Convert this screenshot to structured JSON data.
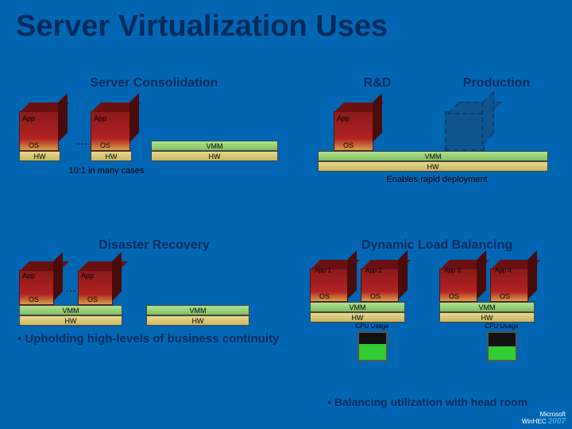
{
  "title": "Server Virtualization Uses",
  "quadrants": {
    "tl": {
      "title": "Server Consolidation",
      "app": "App",
      "os": "OS",
      "hw": "HW",
      "vmm": "VMM",
      "note": "10:1 in many cases",
      "dots": "…"
    },
    "tr": {
      "left_title": "R&D",
      "right_title": "Production",
      "app": "App",
      "os": "OS",
      "vmm": "VMM",
      "hw": "HW",
      "note": "Enables rapid deployment"
    },
    "bl": {
      "title": "Disaster Recovery",
      "app": "App",
      "os": "OS",
      "vmm": "VMM",
      "hw": "HW",
      "dots": "…",
      "bullet": "• Upholding high-levels of business continuity"
    },
    "br": {
      "title": "Dynamic Load Balancing",
      "apps": [
        "App 1",
        "App 2",
        "App 3",
        "App 4"
      ],
      "os": "OS",
      "vmm": "VMM",
      "hw": "HW",
      "cpu_label": "CPU Usage",
      "bullet": "• Balancing utilization with head room"
    }
  },
  "footer": {
    "brand": "Microsoft",
    "event": "WinHEC",
    "year": "2007"
  }
}
